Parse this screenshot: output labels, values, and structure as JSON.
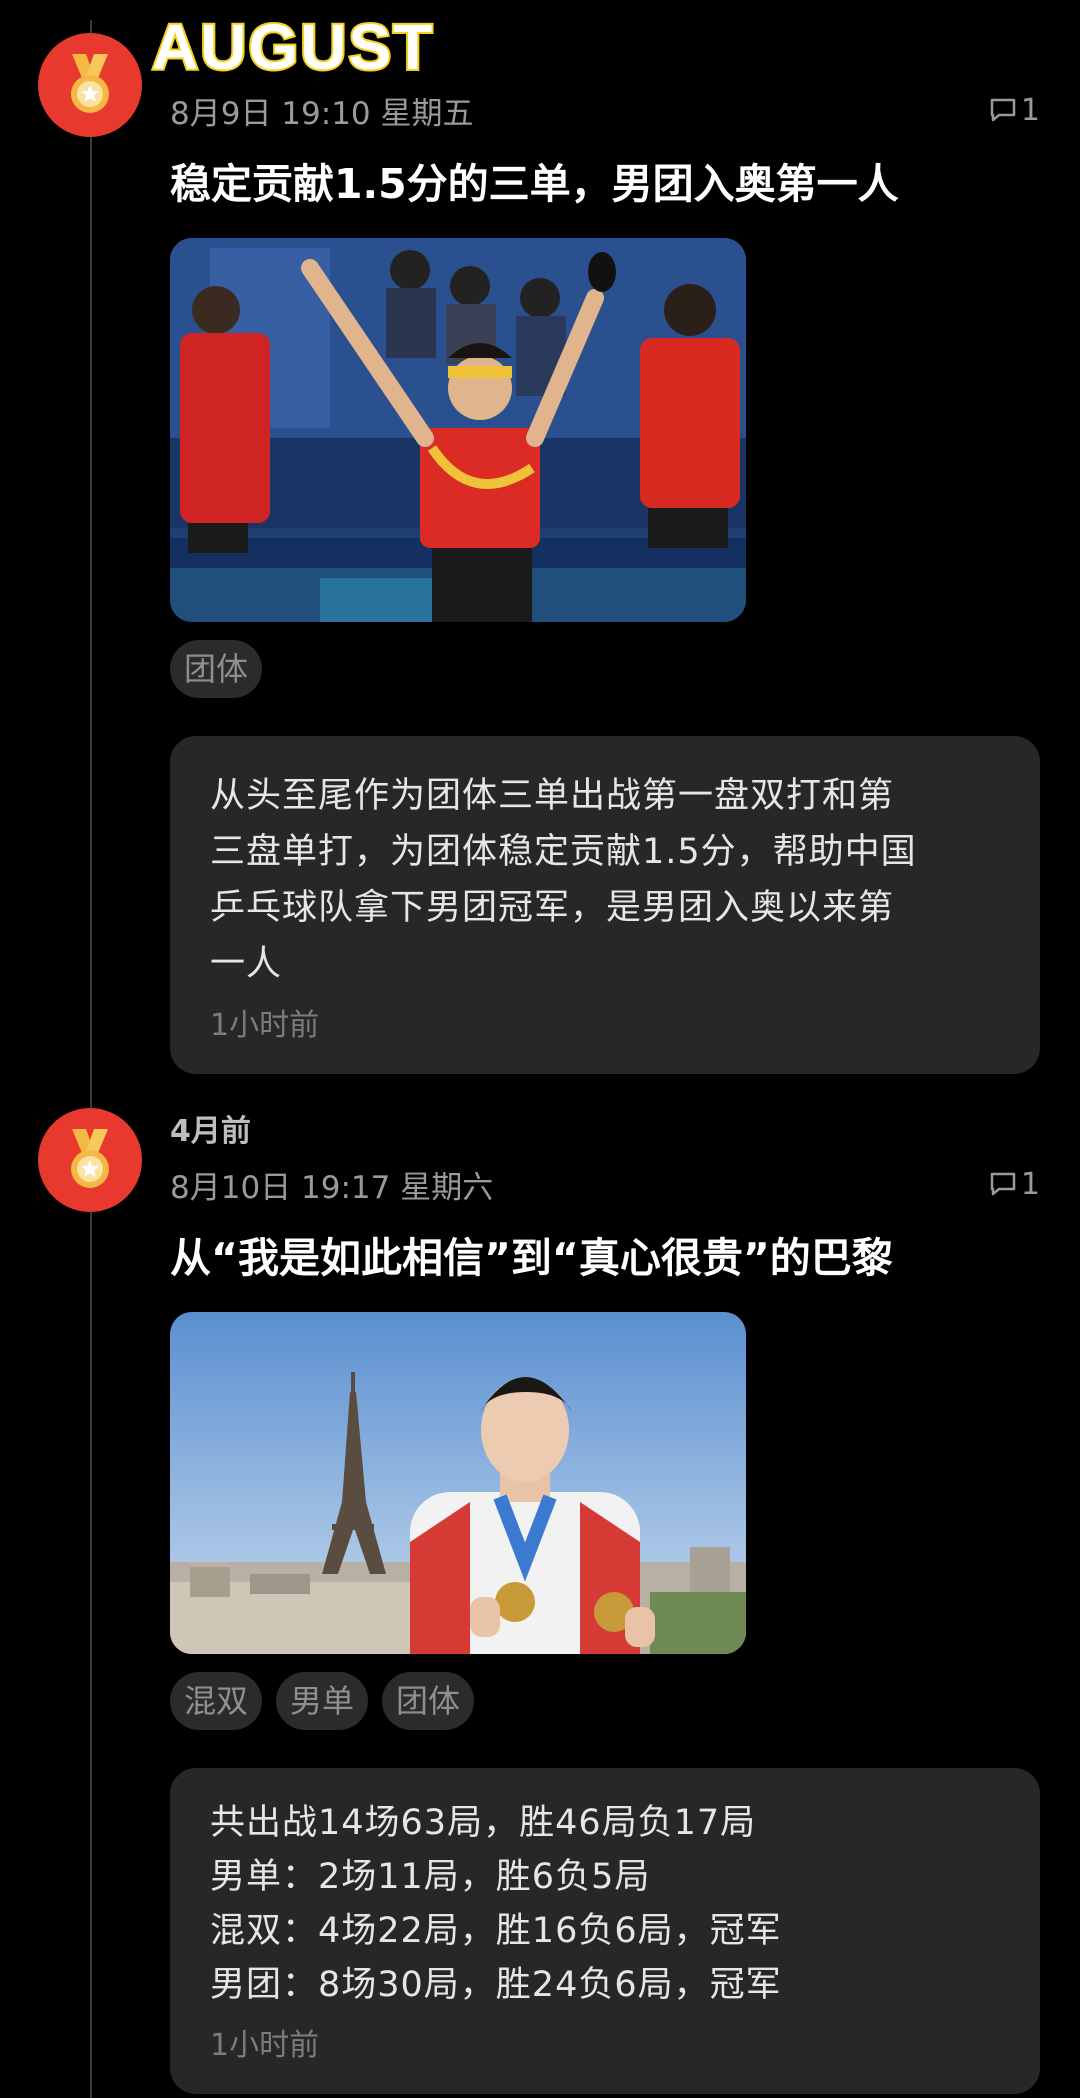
{
  "header": {
    "month": "AUGUST"
  },
  "entries": [
    {
      "relative_time": "",
      "date": "8月9日 19:10 星期五",
      "comment_count": "1",
      "title": "稳定贡献1.5分的三单，男团入奥第一人",
      "tags": [
        "团体"
      ],
      "note_lines": [
        "从头至尾作为团体三单出战第一盘双打和第",
        "三盘单打，为团体稳定贡献1.5分，帮助中国",
        "乒乓球队拿下男团冠军，是男团入奥以来第",
        "一人"
      ],
      "note_time": "1小时前"
    },
    {
      "relative_time": "4月前",
      "date": "8月10日 19:17 星期六",
      "comment_count": "1",
      "title": "从“我是如此相信”到“真心很贵”的巴黎",
      "tags": [
        "混双",
        "男单",
        "团体"
      ],
      "note_lines": [
        "共出战14场63局，胜46局负17局",
        "男单：2场11局，胜6负5局",
        "混双：4场22局，胜16负6局，冠军",
        "男团：8场30局，胜24负6局，冠军"
      ],
      "note_time": "1小时前"
    }
  ],
  "colors": {
    "badge": "#e8392f",
    "medal": "#f4b944",
    "header_outline": "#f3d21c"
  },
  "icons": {
    "badge": "gold-medal-icon",
    "comment": "comment-icon"
  }
}
